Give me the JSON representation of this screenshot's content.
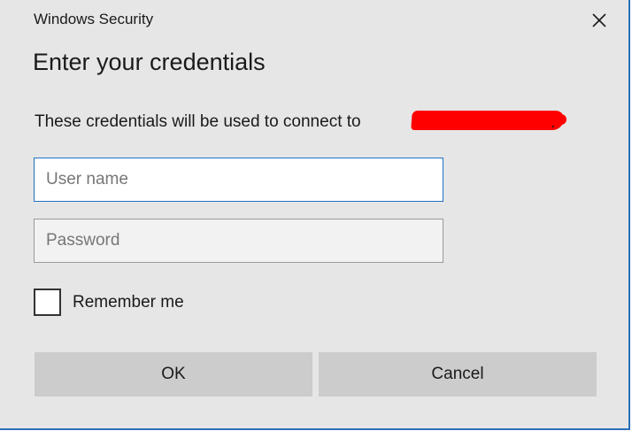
{
  "window": {
    "title": "Windows Security",
    "close_icon": "close-icon"
  },
  "dialog": {
    "heading": "Enter your credentials",
    "info_text": "These credentials will be used to connect to",
    "info_suffix": ".",
    "redaction_color": "#ff0000"
  },
  "form": {
    "username": {
      "placeholder": "User name",
      "value": ""
    },
    "password": {
      "placeholder": "Password",
      "value": ""
    },
    "remember_label": "Remember me",
    "remember_checked": false
  },
  "buttons": {
    "ok_label": "OK",
    "cancel_label": "Cancel"
  },
  "colors": {
    "dialog_bg": "#e6e6e6",
    "accent": "#1f72c4",
    "button_bg": "#cccccc"
  }
}
